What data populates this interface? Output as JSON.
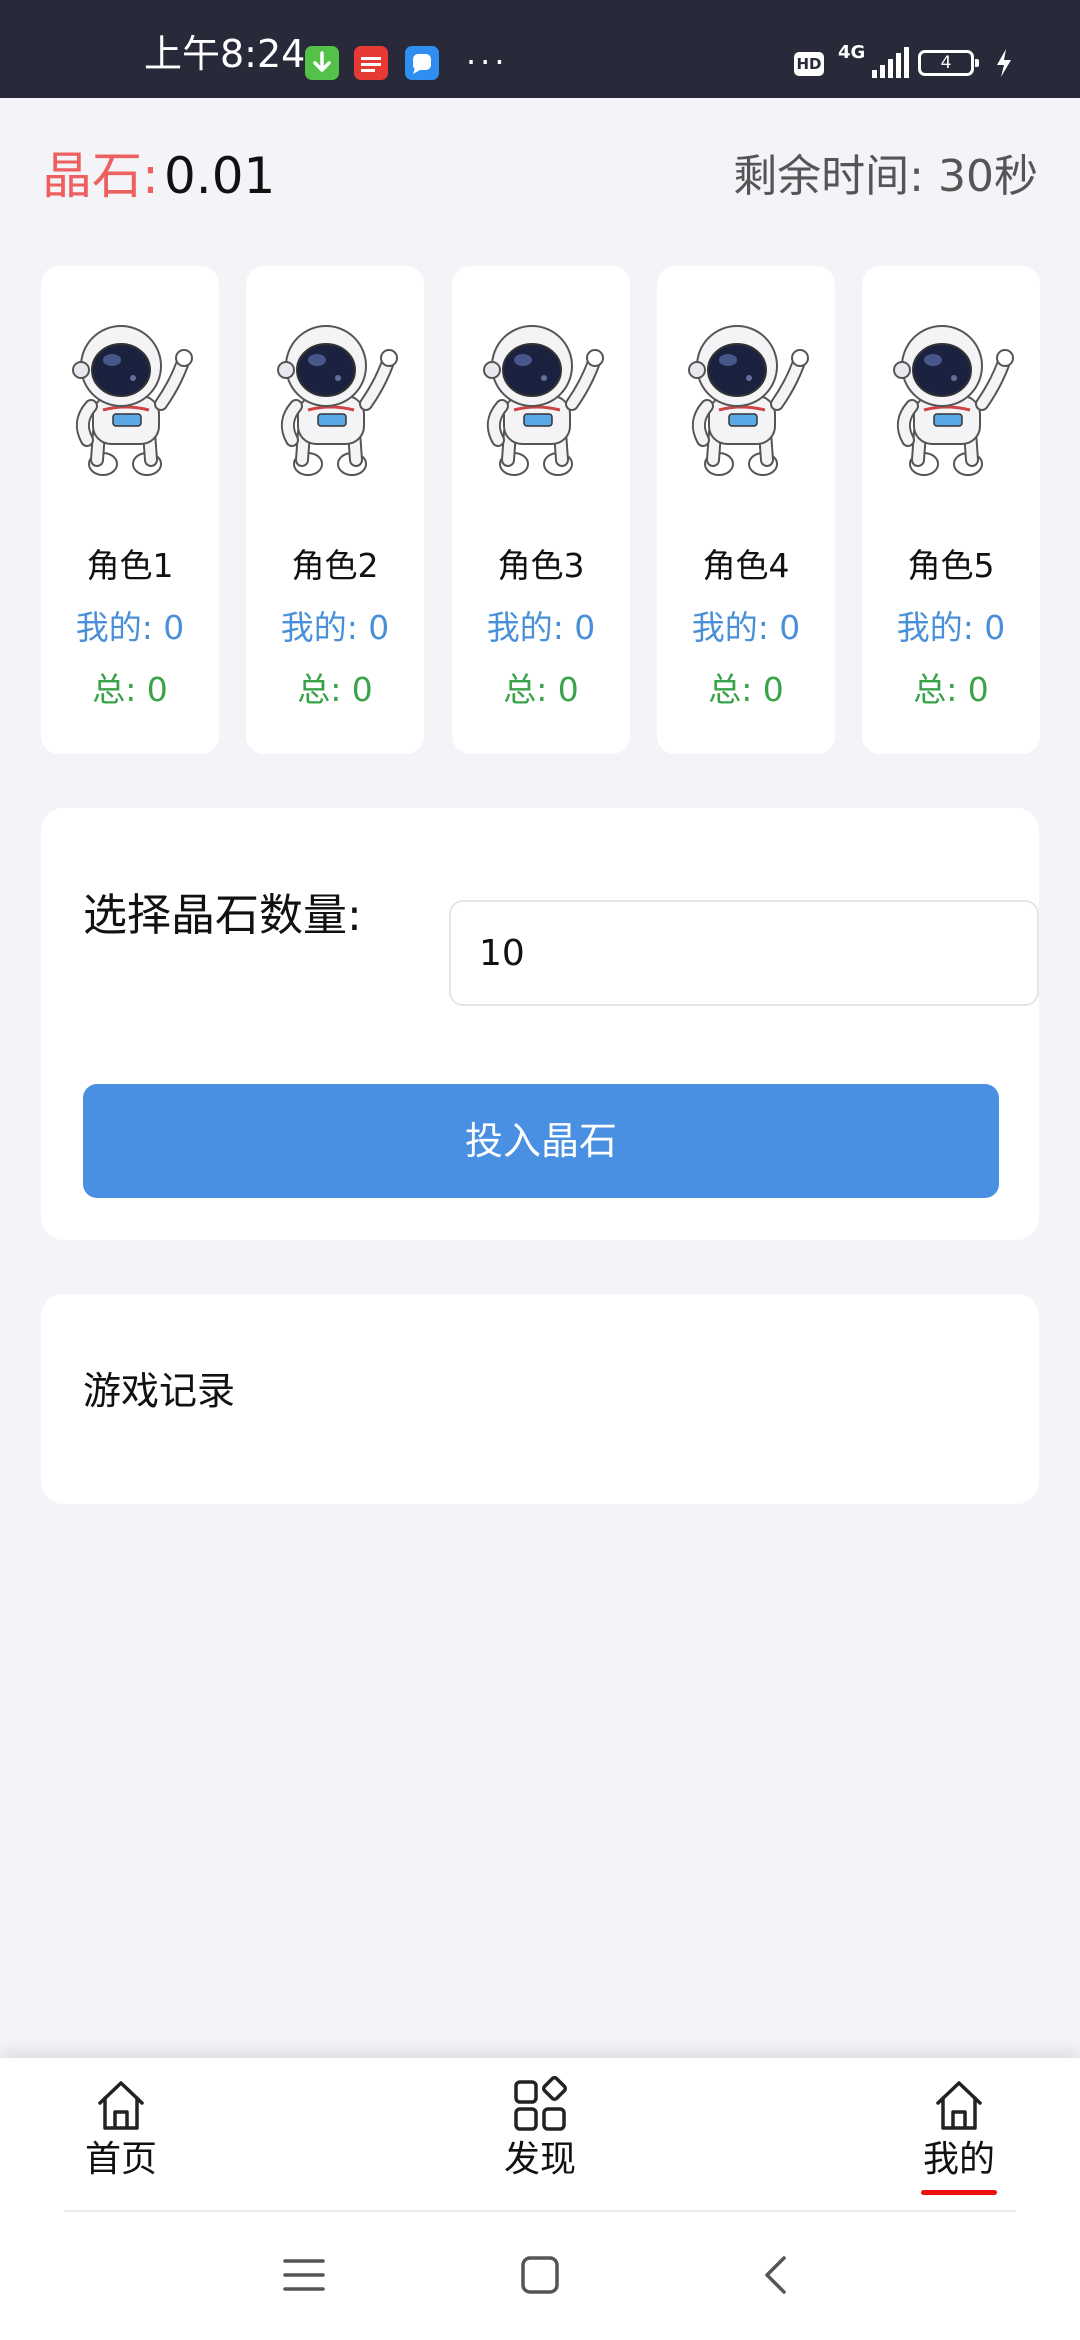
{
  "status_bar": {
    "time": "上午8:24",
    "notification_icons": [
      "download-icon",
      "toutiao-icon",
      "chat-icon"
    ],
    "more": "···",
    "hd_badge": "HD",
    "network": "4G",
    "battery_level": "4"
  },
  "header": {
    "crystal_label": "晶石:",
    "crystal_value": "0.01",
    "timer": "剩余时间: 30秒"
  },
  "characters": [
    {
      "name": "角色1",
      "mine": "我的: 0",
      "total": "总: 0"
    },
    {
      "name": "角色2",
      "mine": "我的: 0",
      "total": "总: 0"
    },
    {
      "name": "角色3",
      "mine": "我的: 0",
      "total": "总: 0"
    },
    {
      "name": "角色4",
      "mine": "我的: 0",
      "total": "总: 0"
    },
    {
      "name": "角色5",
      "mine": "我的: 0",
      "total": "总: 0"
    }
  ],
  "bet": {
    "label": "选择晶石数量:",
    "amount": "10",
    "button": "投入晶石"
  },
  "records": {
    "title": "游戏记录"
  },
  "bottom_nav": {
    "items": [
      {
        "label": "首页",
        "icon": "home-icon"
      },
      {
        "label": "发现",
        "icon": "discover-icon"
      },
      {
        "label": "我的",
        "icon": "home-icon",
        "active": true
      }
    ]
  },
  "colors": {
    "status_bar": "#282a3a",
    "crystal_label": "#ee6060",
    "mine_text": "#4a90d9",
    "total_text": "#3aa34a",
    "primary_button": "#4a90e2",
    "active_underline": "#e11111",
    "background": "#f3f3f8"
  }
}
